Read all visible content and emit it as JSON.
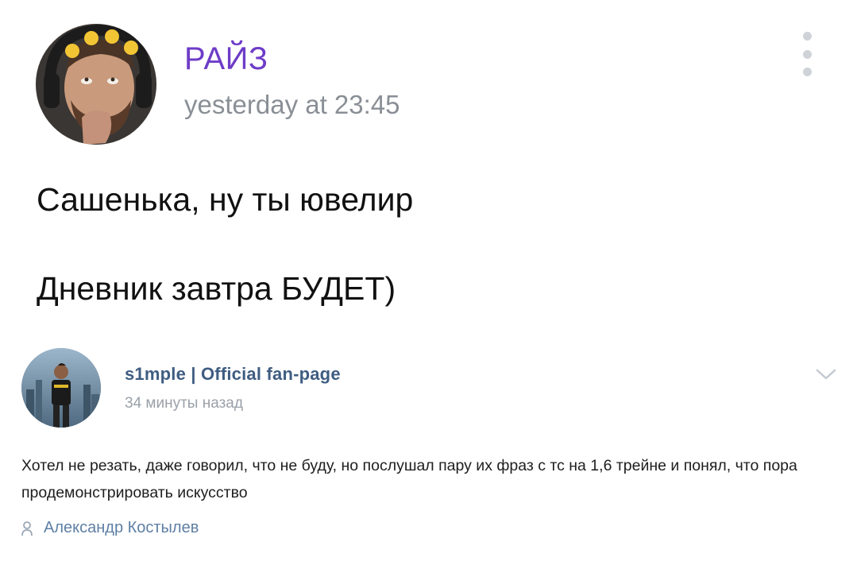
{
  "post_main": {
    "author": "РАЙЗ",
    "time": "yesterday at 23:45",
    "text_lines": [
      "Сашенька, ну ты ювелир",
      "Дневник завтра БУДЕТ)"
    ],
    "menu_icon": "more-vertical-icon"
  },
  "post_quoted": {
    "author": "s1mple | Official fan-page",
    "time": "34 минуты назад",
    "text": "Хотел не резать, даже говорил, что не буду, но послушал пару их фраз с тс на 1,6 трейне и понял, что пора продемонстрировать искусство",
    "signature": "Александр Костылев",
    "signature_icon": "user-icon",
    "expand_icon": "chevron-down-icon"
  },
  "colors": {
    "main_author": "#6e3cc8",
    "time_gray": "#8a8f96",
    "quoted_author": "#3f5d82",
    "signature_blue": "#5e7fa5"
  }
}
